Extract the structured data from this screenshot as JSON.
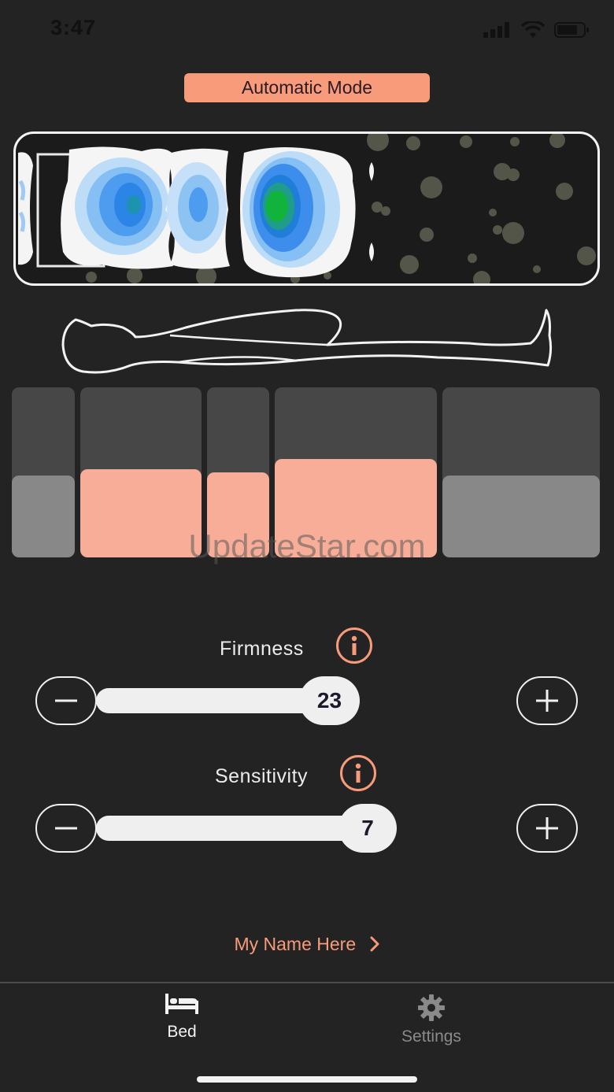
{
  "status_bar": {
    "time": "3:47"
  },
  "mode": {
    "label": "Automatic Mode"
  },
  "zones": [
    {
      "name": "head",
      "level": 0.48,
      "active": false
    },
    {
      "name": "shoulders",
      "level": 0.52,
      "active": true
    },
    {
      "name": "waist",
      "level": 0.5,
      "active": true
    },
    {
      "name": "hips",
      "level": 0.58,
      "active": true
    },
    {
      "name": "legs",
      "level": 0.48,
      "active": false
    }
  ],
  "watermark": "UpdateStar.com",
  "firmness": {
    "label": "Firmness",
    "value": "23",
    "level": 0.23
  },
  "sensitivity": {
    "label": "Sensitivity",
    "value": "7",
    "level": 0.7
  },
  "profile_link": {
    "label": "My Name Here"
  },
  "tabs": [
    {
      "label": "Bed",
      "icon": "bed-icon",
      "active": true
    },
    {
      "label": "Settings",
      "icon": "gear-icon",
      "active": false
    }
  ],
  "colors": {
    "accent": "#f79b7a",
    "zone_active": "#f7ad98",
    "zone_inactive": "#888888",
    "background": "#232323"
  }
}
